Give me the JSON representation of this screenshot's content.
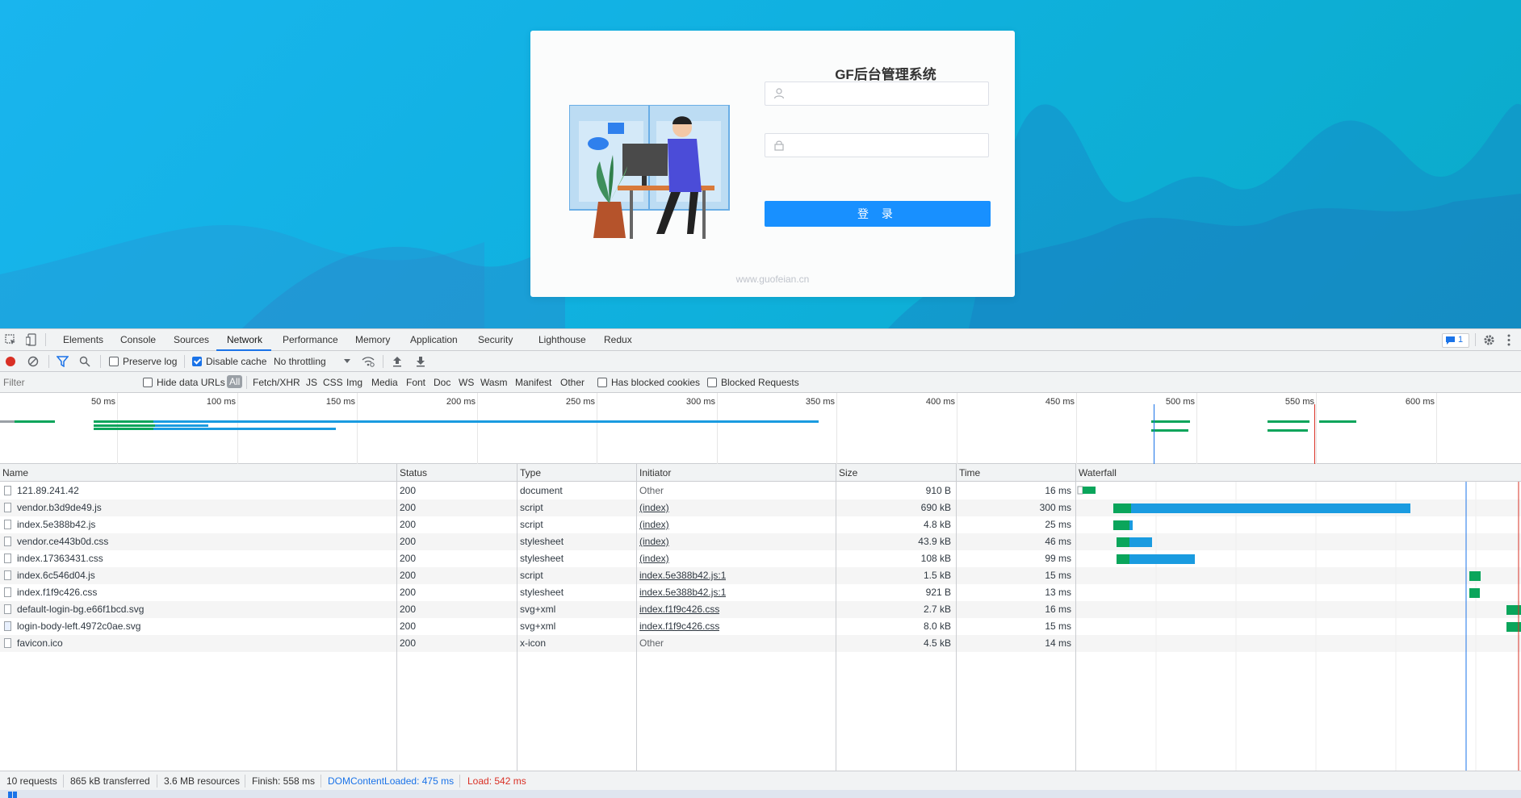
{
  "login": {
    "title": "GF后台管理系统",
    "username_placeholder": "",
    "password_placeholder": "",
    "button_label": "登 录",
    "footer": "www.guofeian.cn"
  },
  "devtools": {
    "tabs": [
      "Elements",
      "Console",
      "Sources",
      "Network",
      "Performance",
      "Memory",
      "Application",
      "Security",
      "Lighthouse",
      "Redux"
    ],
    "active_tab": "Network",
    "issues_badge": "1",
    "toolbar": {
      "preserve_log": "Preserve log",
      "disable_cache": "Disable cache",
      "throttling": "No throttling"
    },
    "filterbar": {
      "filter_placeholder": "Filter",
      "hide_data_urls": "Hide data URLs",
      "types": [
        "All",
        "Fetch/XHR",
        "JS",
        "CSS",
        "Img",
        "Media",
        "Font",
        "Doc",
        "WS",
        "Wasm",
        "Manifest",
        "Other"
      ],
      "has_blocked_cookies": "Has blocked cookies",
      "blocked_requests": "Blocked Requests"
    },
    "overview_ticks": [
      "50 ms",
      "100 ms",
      "150 ms",
      "200 ms",
      "250 ms",
      "300 ms",
      "350 ms",
      "400 ms",
      "450 ms",
      "500 ms",
      "550 ms",
      "600 ms"
    ],
    "columns": [
      "Name",
      "Status",
      "Type",
      "Initiator",
      "Size",
      "Time",
      "Waterfall"
    ],
    "rows": [
      {
        "name": "121.89.241.42",
        "status": "200",
        "type": "document",
        "initiator": "Other",
        "size": "910 B",
        "time": "16 ms"
      },
      {
        "name": "vendor.b3d9de49.js",
        "status": "200",
        "type": "script",
        "initiator": "(index)",
        "size": "690 kB",
        "time": "300 ms"
      },
      {
        "name": "index.5e388b42.js",
        "status": "200",
        "type": "script",
        "initiator": "(index)",
        "size": "4.8 kB",
        "time": "25 ms"
      },
      {
        "name": "vendor.ce443b0d.css",
        "status": "200",
        "type": "stylesheet",
        "initiator": "(index)",
        "size": "43.9 kB",
        "time": "46 ms"
      },
      {
        "name": "index.17363431.css",
        "status": "200",
        "type": "stylesheet",
        "initiator": "(index)",
        "size": "108 kB",
        "time": "99 ms"
      },
      {
        "name": "index.6c546d04.js",
        "status": "200",
        "type": "script",
        "initiator": "index.5e388b42.js:1",
        "size": "1.5 kB",
        "time": "15 ms"
      },
      {
        "name": "index.f1f9c426.css",
        "status": "200",
        "type": "stylesheet",
        "initiator": "index.5e388b42.js:1",
        "size": "921 B",
        "time": "13 ms"
      },
      {
        "name": "default-login-bg.e66f1bcd.svg",
        "status": "200",
        "type": "svg+xml",
        "initiator": "index.f1f9c426.css",
        "size": "2.7 kB",
        "time": "16 ms"
      },
      {
        "name": "login-body-left.4972c0ae.svg",
        "status": "200",
        "type": "svg+xml",
        "initiator": "index.f1f9c426.css",
        "size": "8.0 kB",
        "time": "15 ms"
      },
      {
        "name": "favicon.ico",
        "status": "200",
        "type": "x-icon",
        "initiator": "Other",
        "size": "4.5 kB",
        "time": "14 ms"
      }
    ],
    "status": {
      "requests": "10 requests",
      "transferred": "865 kB transferred",
      "resources": "3.6 MB resources",
      "finish": "Finish: 558 ms",
      "dcl": "DOMContentLoaded: 475 ms",
      "load": "Load: 542 ms"
    },
    "colors": {
      "accent": "#1a73e8",
      "waiting": "#0aa55b",
      "download": "#1a9be0",
      "load_line": "#d93025"
    }
  }
}
